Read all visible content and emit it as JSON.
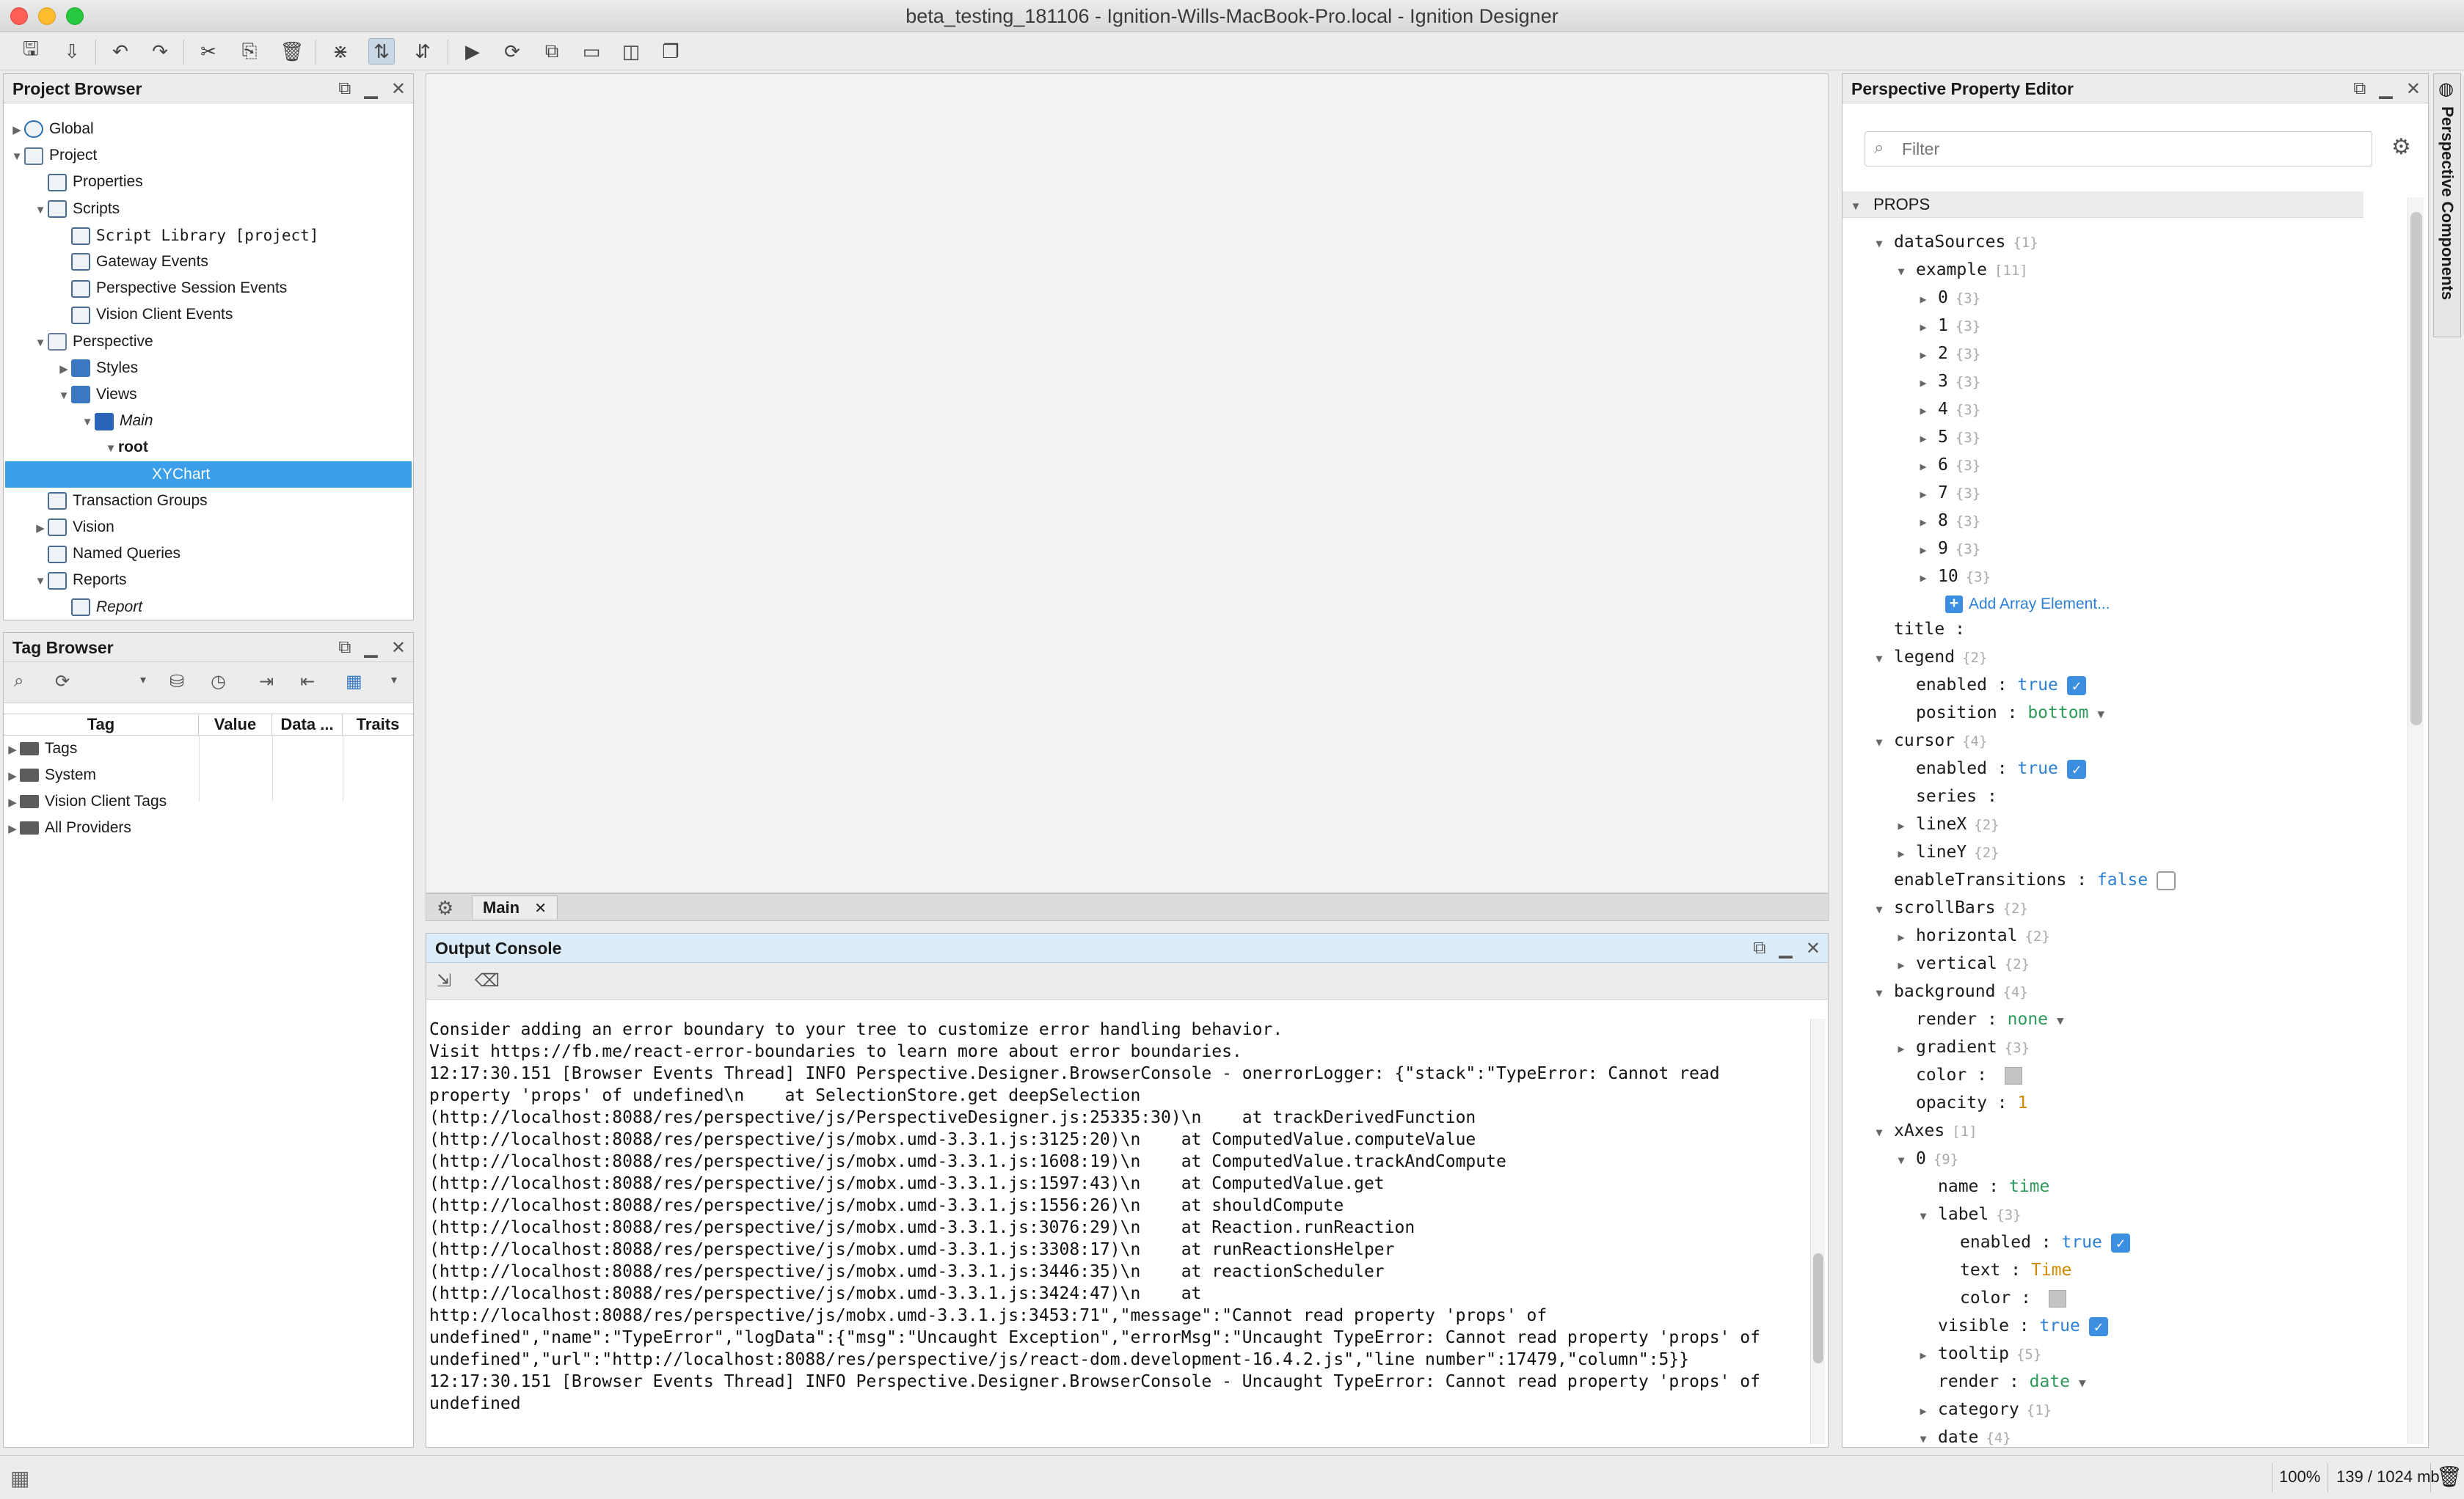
{
  "window": {
    "title": "beta_testing_181106 - Ignition-Wills-MacBook-Pro.local - Ignition Designer"
  },
  "colors": {
    "accent": "#3b8ee0",
    "selection": "#3b9ee8",
    "link": "#2d7fd3"
  },
  "project_browser": {
    "title": "Project Browser",
    "items": [
      {
        "label": "Global",
        "icon": "globe-icon"
      },
      {
        "label": "Project",
        "icon": "project-icon"
      },
      {
        "label": "Properties",
        "icon": "properties-icon"
      },
      {
        "label": "Scripts",
        "icon": "scripts-icon"
      },
      {
        "label": "Script Library [project]",
        "icon": "script-library-icon"
      },
      {
        "label": "Gateway Events",
        "icon": "script-icon"
      },
      {
        "label": "Perspective Session Events",
        "icon": "script-icon"
      },
      {
        "label": "Vision Client Events",
        "icon": "script-icon"
      },
      {
        "label": "Perspective",
        "icon": "perspective-icon"
      },
      {
        "label": "Styles",
        "icon": "folder-icon"
      },
      {
        "label": "Views",
        "icon": "folder-icon"
      },
      {
        "label": "Main",
        "icon": "view-icon"
      },
      {
        "label": "root",
        "icon": ""
      },
      {
        "label": "XYChart",
        "icon": ""
      },
      {
        "label": "Transaction Groups",
        "icon": "transaction-icon"
      },
      {
        "label": "Vision",
        "icon": "vision-icon"
      },
      {
        "label": "Named Queries",
        "icon": "query-icon"
      },
      {
        "label": "Reports",
        "icon": "reports-icon"
      },
      {
        "label": "Report",
        "icon": "report-icon"
      }
    ]
  },
  "tag_browser": {
    "title": "Tag Browser",
    "columns": [
      "Tag",
      "Value",
      "Data ...",
      "Traits"
    ],
    "rows": [
      "Tags",
      "System",
      "Vision Client Tags",
      "All Providers"
    ]
  },
  "workspace": {
    "tab_label": "Main"
  },
  "output_console": {
    "title": "Output Console",
    "lines": [
      "Consider adding an error boundary to your tree to customize error handling behavior.",
      "Visit https://fb.me/react-error-boundaries to learn more about error boundaries.",
      "12:17:30.151 [Browser Events Thread] INFO Perspective.Designer.BrowserConsole - onerrorLogger: {\"stack\":\"TypeError: Cannot read",
      "property 'props' of undefined\\n    at SelectionStore.get deepSelection",
      "(http://localhost:8088/res/perspective/js/PerspectiveDesigner.js:25335:30)\\n    at trackDerivedFunction",
      "(http://localhost:8088/res/perspective/js/mobx.umd-3.3.1.js:3125:20)\\n    at ComputedValue.computeValue",
      "(http://localhost:8088/res/perspective/js/mobx.umd-3.3.1.js:1608:19)\\n    at ComputedValue.trackAndCompute",
      "(http://localhost:8088/res/perspective/js/mobx.umd-3.3.1.js:1597:43)\\n    at ComputedValue.get",
      "(http://localhost:8088/res/perspective/js/mobx.umd-3.3.1.js:1556:26)\\n    at shouldCompute",
      "(http://localhost:8088/res/perspective/js/mobx.umd-3.3.1.js:3076:29)\\n    at Reaction.runReaction",
      "(http://localhost:8088/res/perspective/js/mobx.umd-3.3.1.js:3308:17)\\n    at runReactionsHelper",
      "(http://localhost:8088/res/perspective/js/mobx.umd-3.3.1.js:3446:35)\\n    at reactionScheduler",
      "(http://localhost:8088/res/perspective/js/mobx.umd-3.3.1.js:3424:47)\\n    at",
      "http://localhost:8088/res/perspective/js/mobx.umd-3.3.1.js:3453:71\",\"message\":\"Cannot read property 'props' of",
      "undefined\",\"name\":\"TypeError\",\"logData\":{\"msg\":\"Uncaught Exception\",\"errorMsg\":\"Uncaught TypeError: Cannot read property 'props' of",
      "undefined\",\"url\":\"http://localhost:8088/res/perspective/js/react-dom.development-16.4.2.js\",\"line number\":17479,\"column\":5}}",
      "12:17:30.151 [Browser Events Thread] INFO Perspective.Designer.BrowserConsole - Uncaught TypeError: Cannot read property 'props' of",
      "undefined"
    ]
  },
  "property_editor": {
    "title": "Perspective Property Editor",
    "filter_placeholder": "Filter",
    "section": "PROPS",
    "side_tab": "Perspective Components",
    "add_array": "Add Array Element...",
    "rows": [
      {
        "key": "dataSources",
        "count": "{1}"
      },
      {
        "key": "example",
        "count": "[11]"
      },
      {
        "key": "0",
        "count": "{3}"
      },
      {
        "key": "1",
        "count": "{3}"
      },
      {
        "key": "2",
        "count": "{3}"
      },
      {
        "key": "3",
        "count": "{3}"
      },
      {
        "key": "4",
        "count": "{3}"
      },
      {
        "key": "5",
        "count": "{3}"
      },
      {
        "key": "6",
        "count": "{3}"
      },
      {
        "key": "7",
        "count": "{3}"
      },
      {
        "key": "8",
        "count": "{3}"
      },
      {
        "key": "9",
        "count": "{3}"
      },
      {
        "key": "10",
        "count": "{3}"
      },
      {
        "key": "title",
        "count": ""
      },
      {
        "key": "legend",
        "count": "{2}"
      },
      {
        "key": "enabled",
        "value": "true"
      },
      {
        "key": "position",
        "value": "bottom"
      },
      {
        "key": "cursor",
        "count": "{4}"
      },
      {
        "key": "enabled",
        "value": "true"
      },
      {
        "key": "series",
        "count": ""
      },
      {
        "key": "lineX",
        "count": "{2}"
      },
      {
        "key": "lineY",
        "count": "{2}"
      },
      {
        "key": "enableTransitions",
        "value": "false"
      },
      {
        "key": "scrollBars",
        "count": "{2}"
      },
      {
        "key": "horizontal",
        "count": "{2}"
      },
      {
        "key": "vertical",
        "count": "{2}"
      },
      {
        "key": "background",
        "count": "{4}"
      },
      {
        "key": "render",
        "value": "none"
      },
      {
        "key": "gradient",
        "count": "{3}"
      },
      {
        "key": "color",
        "count": ""
      },
      {
        "key": "opacity",
        "value": "1"
      },
      {
        "key": "xAxes",
        "count": "[1]"
      },
      {
        "key": "0",
        "count": "{9}"
      },
      {
        "key": "name",
        "value": "time"
      },
      {
        "key": "label",
        "count": "{3}"
      },
      {
        "key": "enabled",
        "value": "true"
      },
      {
        "key": "text",
        "value": "Time"
      },
      {
        "key": "color",
        "count": ""
      },
      {
        "key": "visible",
        "value": "true"
      },
      {
        "key": "tooltip",
        "count": "{5}"
      },
      {
        "key": "render",
        "value": "date"
      },
      {
        "key": "category",
        "count": "{1}"
      },
      {
        "key": "date",
        "count": "{4}"
      }
    ]
  },
  "status": {
    "zoom": "100%",
    "memory": "139 / 1024 mb"
  }
}
